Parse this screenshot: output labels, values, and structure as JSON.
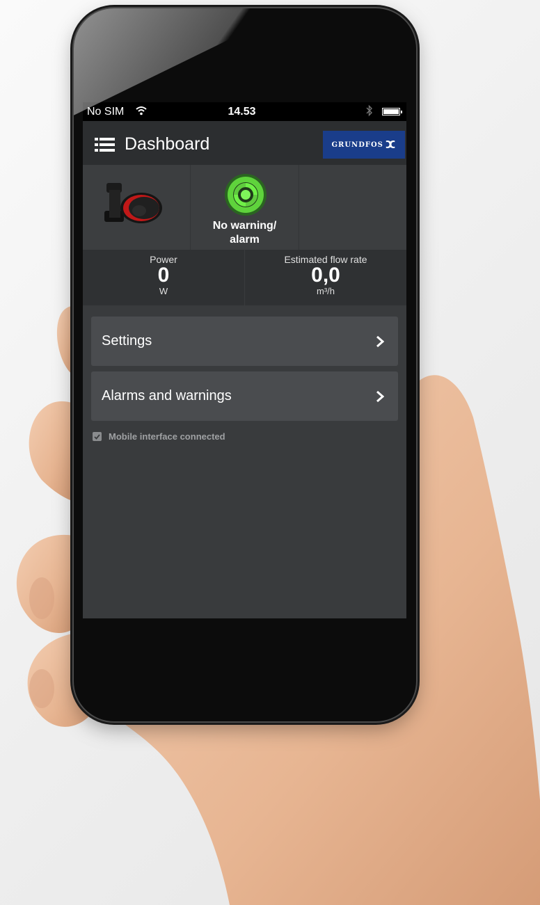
{
  "status_bar": {
    "carrier": "No SIM",
    "time": "14.53",
    "wifi_icon": "wifi-icon",
    "bluetooth_icon": "bluetooth-icon",
    "battery_icon": "battery-icon",
    "battery_level": 1.0
  },
  "header": {
    "menu_icon": "hamburger-menu-icon",
    "title": "Dashboard",
    "brand": "GRUNDFOS",
    "brand_color": "#1a3d8a"
  },
  "status": {
    "pump_icon": "pump-icon",
    "indicator_icon": "status-ok-icon",
    "indicator_color": "#5fd33c",
    "text": "No warning/\nalarm"
  },
  "readings": [
    {
      "label": "Power",
      "value": "0",
      "unit": "W"
    },
    {
      "label": "Estimated flow rate",
      "value": "0,0",
      "unit": "m³/h"
    }
  ],
  "nav": [
    {
      "label": "Settings",
      "icon": "chevron-right-icon"
    },
    {
      "label": "Alarms and warnings",
      "icon": "chevron-right-icon"
    }
  ],
  "connection": {
    "checked": true,
    "text": "Mobile interface connected"
  },
  "colors": {
    "screen_bg": "#393b3d",
    "header_bg": "#2c2e30",
    "button_bg": "#4a4c4f"
  }
}
